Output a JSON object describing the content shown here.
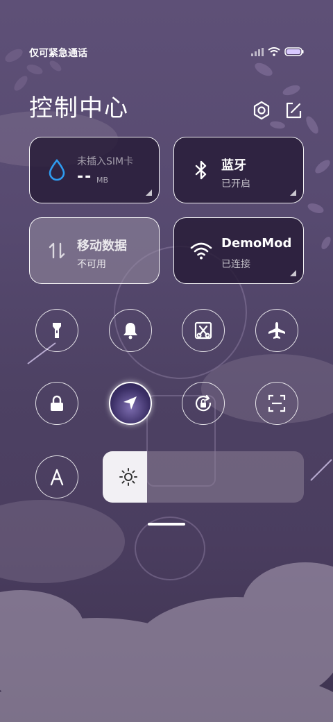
{
  "status_bar": {
    "carrier_text": "仅可紧急通话"
  },
  "header": {
    "title": "控制中心"
  },
  "tiles": {
    "data": {
      "label": "未插入SIM卡",
      "value": "--",
      "unit": "MB"
    },
    "bluetooth": {
      "label": "蓝牙",
      "status": "已开启"
    },
    "mobile_data": {
      "label": "移动数据",
      "status": "不可用"
    },
    "wifi": {
      "label": "DemoMod",
      "status": "已连接"
    }
  },
  "toggles": [
    {
      "name": "flashlight-icon",
      "active": false
    },
    {
      "name": "bell-icon",
      "active": false
    },
    {
      "name": "screenshot-icon",
      "active": false
    },
    {
      "name": "airplane-icon",
      "active": false
    },
    {
      "name": "lock-icon",
      "active": false
    },
    {
      "name": "location-icon",
      "active": true
    },
    {
      "name": "rotation-lock-icon",
      "active": false
    },
    {
      "name": "scan-icon",
      "active": false
    },
    {
      "name": "auto-text-icon",
      "active": false
    }
  ],
  "brightness": {
    "level": 0.22
  },
  "colors": {
    "accent_blue": "#2e9bf0",
    "active_toggle": "#3b2f66"
  }
}
